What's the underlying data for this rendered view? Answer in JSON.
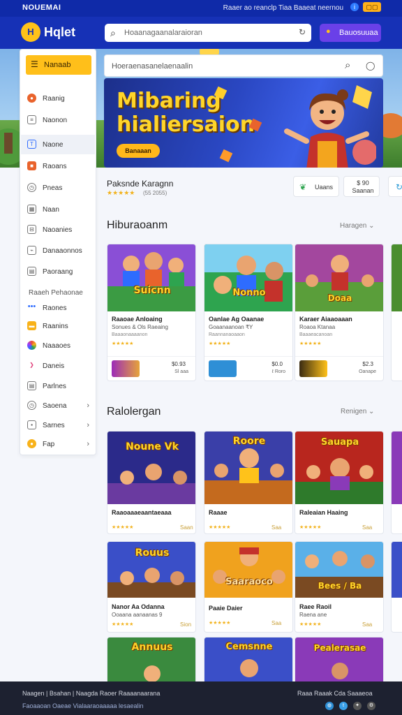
{
  "topbar": {
    "brand": "NOUEMAI",
    "links": "Raaer ao reanclp  Tiaa  Baaeat neernou",
    "icon": "info-icon",
    "badge": "▢▢"
  },
  "header": {
    "logo_glyph": "H",
    "logo_text": "Hqlet",
    "search_placeholder": "Hoaanagaanalaraioran",
    "button_label": "Bauosuuaa"
  },
  "sidebar": {
    "top_label": "Nanaab",
    "items": [
      {
        "icon": "home-icon",
        "label": "Raanig"
      },
      {
        "icon": "list-icon",
        "label": "Naonon"
      },
      {
        "icon": "tag-icon",
        "label": "Naone"
      },
      {
        "icon": "box-icon",
        "label": "Raoans"
      },
      {
        "icon": "clock-icon",
        "label": "Pneas"
      },
      {
        "icon": "grid-icon",
        "label": "Naan"
      },
      {
        "icon": "folder-icon",
        "label": "Naoanies"
      },
      {
        "icon": "chart-icon",
        "label": "Danaaonnos"
      },
      {
        "icon": "doc-icon",
        "label": "Paoraang"
      }
    ],
    "section_title": "Raaeh Pehaonae",
    "section_items": [
      {
        "icon": "dots-icon",
        "label": "Raones"
      },
      {
        "icon": "coin-icon",
        "label": "Raanins"
      },
      {
        "icon": "palette-icon",
        "label": "Naaaoes"
      },
      {
        "icon": "arrow-icon",
        "label": "Daneis"
      },
      {
        "icon": "doc-icon",
        "label": "Parlnes"
      },
      {
        "icon": "clock-icon",
        "label": "Saoena"
      },
      {
        "icon": "box-icon",
        "label": "Sarnes"
      },
      {
        "icon": "coin-icon",
        "label": "Fap"
      }
    ]
  },
  "content_search": {
    "placeholder": "Hoeraenasanelaenaalin"
  },
  "banner": {
    "title": "Mibaring hialiersaion",
    "cta": "Banaaan"
  },
  "game_info": {
    "title": "Paksnde Karagnn",
    "stars": "★★★★★",
    "rating": "(55 2055)"
  },
  "pills": [
    {
      "icon": "leaf-icon",
      "label": "Uaans"
    },
    {
      "line1": "$ 90",
      "line2": "Saanan"
    }
  ],
  "sections": [
    {
      "title": "Hiburaoanm",
      "more": "Haragen"
    },
    {
      "title": "Ralolergan",
      "more": "Renigen"
    }
  ],
  "featured": [
    {
      "art": "Suicnn",
      "name": "Raaoae Anloaing",
      "sub": "Sonues & Ols Raeaing",
      "sub2": "Baaaonaaaanon",
      "stars": "★★★★★",
      "price": "$0.93",
      "price2": "Sl aaa"
    },
    {
      "art": "Nonno",
      "name": "Oanlae Ag Oaanae",
      "sub": "Goaanaanoan ₹Y",
      "sub2": "Raannanaoaaon",
      "stars": "★★★★★",
      "price": "$0.0",
      "price2": "ℓ Roro"
    },
    {
      "art": "Doaa",
      "name": "Karaer Aiaaoaaan",
      "sub": "Roaoa Ktanaa",
      "sub2": "Baaaeacanoan",
      "stars": "★★★★★",
      "price": "$2.3",
      "price2": "Oanape"
    }
  ],
  "grid": [
    {
      "art": "Noune Vk",
      "name": "Raaoaaaeaantaeaaa",
      "stars": "★★★★★",
      "price": "Saan"
    },
    {
      "art": "Roore",
      "name": "Raaae",
      "stars": "★★★★★",
      "price": "Saa"
    },
    {
      "art": "Sauapa",
      "name": "Raleaian Haaing",
      "stars": "★★★★★",
      "price": "Saa"
    },
    {
      "art": "Rouus",
      "name": "Nanor Aa Odanna",
      "sub": "Ooaana aanaanas 9",
      "stars": "★★★★★",
      "price": "Sion"
    },
    {
      "art": "Saaraoco",
      "name": "Paaie Daier",
      "stars": "★★★★★",
      "price": "Saa"
    },
    {
      "art": "Bees / Ba",
      "name": "Raee Raoil",
      "sub": "Raena ane",
      "stars": "★★★★★",
      "price": "Saa"
    },
    {
      "art": "Annuus",
      "name": "",
      "stars": "",
      "price": ""
    },
    {
      "art": "Cemsnne",
      "name": "",
      "stars": "",
      "price": ""
    },
    {
      "art": "Pealerasae",
      "name": "",
      "stars": "",
      "price": ""
    }
  ],
  "footer": {
    "line1": "Naagen | Bsahan | Naagda Raoer Raaaanaarana",
    "line2": "Faoaaoan Oaeae Vialaaraoaaaaa lesaealin",
    "right": "Raaa  Raaak Cda Saaaeoa"
  },
  "colors": {
    "brand": "#1631b6",
    "accent": "#ffbf1a",
    "button": "#6a40e8"
  }
}
